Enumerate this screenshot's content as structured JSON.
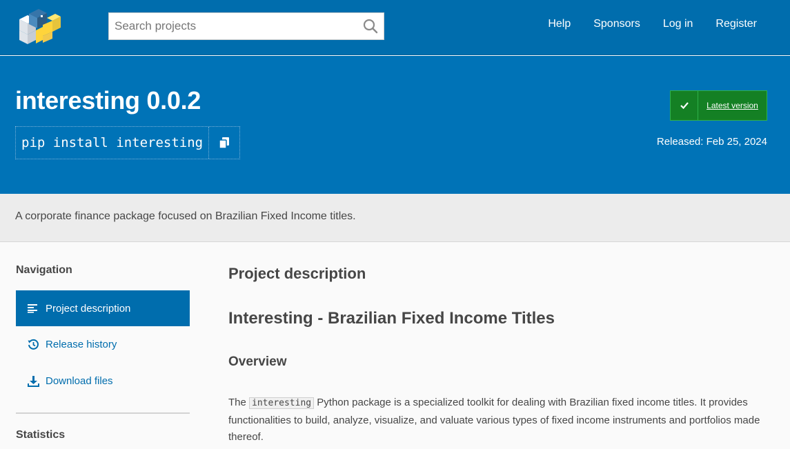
{
  "header": {
    "search_placeholder": "Search projects",
    "nav": [
      "Help",
      "Sponsors",
      "Log in",
      "Register"
    ]
  },
  "banner": {
    "title": "interesting 0.0.2",
    "pip_command": "pip install interesting",
    "latest_label": "Latest version",
    "released": "Released: Feb 25, 2024"
  },
  "summary": "A corporate finance package focused on Brazilian Fixed Income titles.",
  "sidebar": {
    "heading": "Navigation",
    "items": [
      {
        "label": "Project description",
        "icon": "align-left-icon",
        "active": true
      },
      {
        "label": "Release history",
        "icon": "history-icon",
        "active": false
      },
      {
        "label": "Download files",
        "icon": "download-icon",
        "active": false
      }
    ],
    "statistics_heading": "Statistics"
  },
  "main": {
    "section_heading": "Project description",
    "title": "Interesting - Brazilian Fixed Income Titles",
    "overview_heading": "Overview",
    "paragraph_before": "The ",
    "paragraph_code": "interesting",
    "paragraph_after": " Python package is a specialized toolkit for dealing with Brazilian fixed income titles. It provides functionalities to build, analyze, visualize, and valuate various types of fixed income instruments and portfolios made thereof."
  },
  "colors": {
    "header_blue": "#006dad",
    "banner_blue": "#0073b7",
    "latest_green": "#148024",
    "summary_gray": "#ececec"
  }
}
